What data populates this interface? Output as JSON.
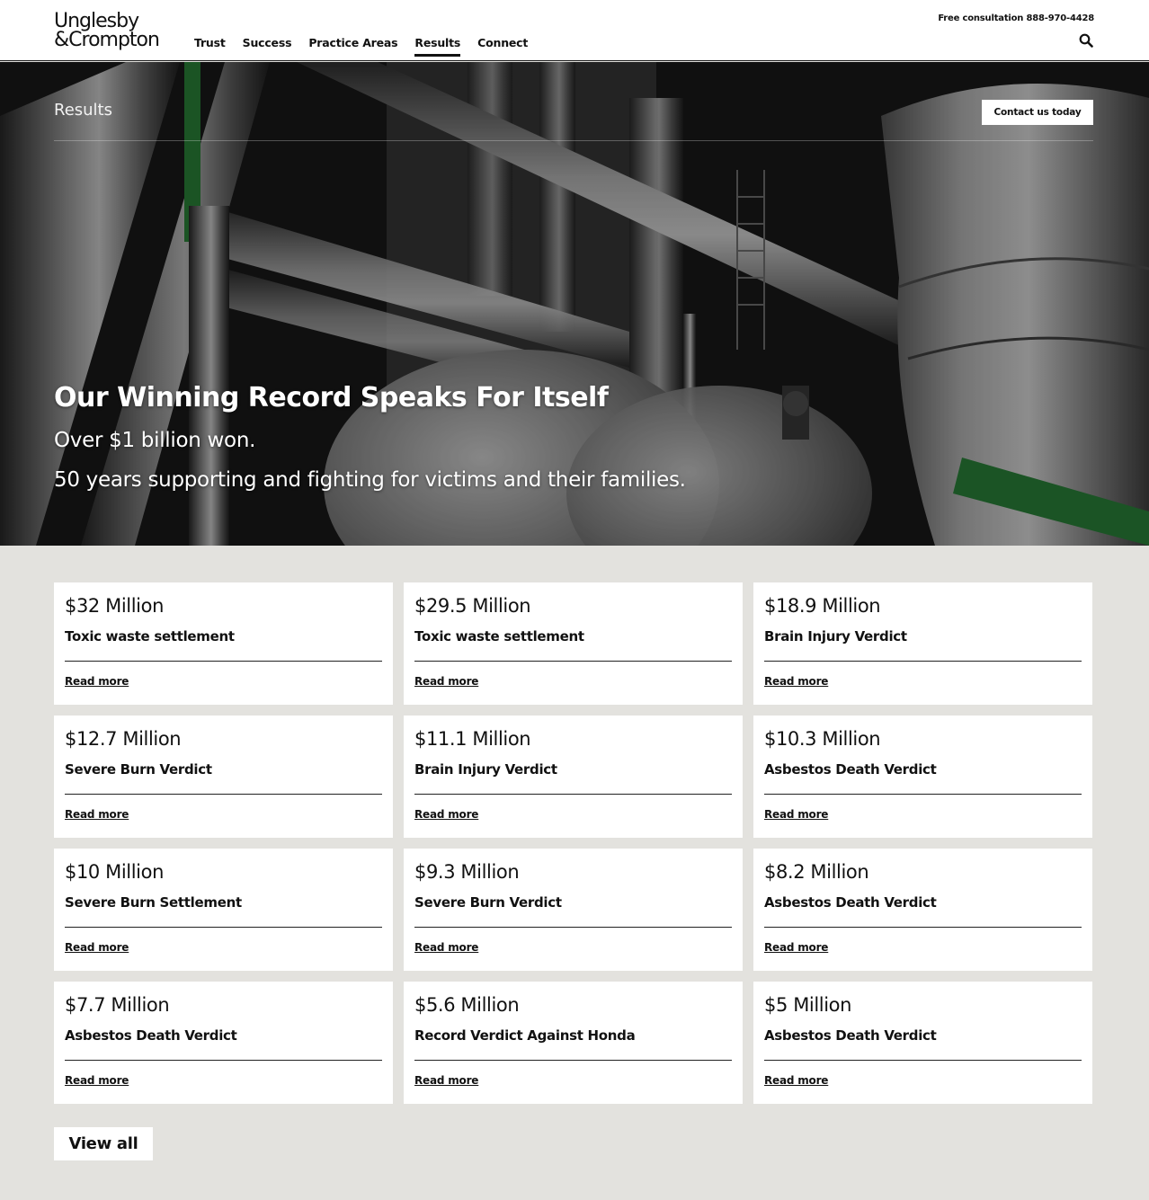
{
  "brand": {
    "logo_line1": "Unglesby",
    "logo_line2": "&Crompton"
  },
  "nav": {
    "items": [
      {
        "label": "Trust"
      },
      {
        "label": "Success"
      },
      {
        "label": "Practice Areas"
      },
      {
        "label": "Results",
        "active": true
      },
      {
        "label": "Connect"
      }
    ]
  },
  "header": {
    "consultation": "Free consultation 888-970-4428",
    "search_icon": "search-icon"
  },
  "hero": {
    "breadcrumb": "Results",
    "contact_button": "Contact us today",
    "title": "Our Winning Record Speaks For Itself",
    "subtitle_1": "Over $1 billion won.",
    "subtitle_2": "50 years supporting and fighting for victims and their families."
  },
  "results": [
    {
      "amount": "$32 Million",
      "title": "Toxic waste settlement",
      "link": "Read more"
    },
    {
      "amount": "$29.5 Million",
      "title": "Toxic waste settlement",
      "link": "Read more"
    },
    {
      "amount": "$18.9 Million",
      "title": "Brain Injury Verdict",
      "link": "Read more"
    },
    {
      "amount": "$12.7 Million",
      "title": "Severe Burn Verdict",
      "link": "Read more"
    },
    {
      "amount": "$11.1 Million",
      "title": "Brain Injury Verdict",
      "link": "Read more"
    },
    {
      "amount": "$10.3 Million",
      "title": "Asbestos Death Verdict",
      "link": "Read more"
    },
    {
      "amount": "$10 Million",
      "title": "Severe Burn Settlement",
      "link": "Read more"
    },
    {
      "amount": "$9.3 Million",
      "title": "Severe Burn Verdict",
      "link": "Read more"
    },
    {
      "amount": "$8.2 Million",
      "title": "Asbestos Death Verdict",
      "link": "Read more"
    },
    {
      "amount": "$7.7 Million",
      "title": "Asbestos Death Verdict",
      "link": "Read more"
    },
    {
      "amount": "$5.6 Million",
      "title": "Record Verdict Against Honda",
      "link": "Read more"
    },
    {
      "amount": "$5 Million",
      "title": "Asbestos Death Verdict",
      "link": "Read more"
    }
  ],
  "footer_actions": {
    "view_all": "View all"
  },
  "colors": {
    "page_bg": "#e3e2de",
    "text": "#111111",
    "card_bg": "#ffffff",
    "accent_green": "#2d8a3e"
  }
}
